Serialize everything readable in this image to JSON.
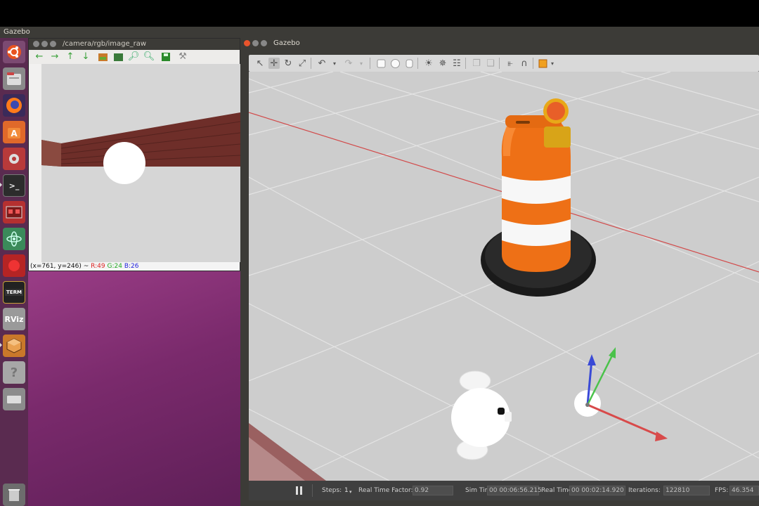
{
  "topbar": {
    "title": "Gazebo"
  },
  "image_window": {
    "title": "/camera/rgb/image_raw",
    "status": {
      "coords": "(x=761, y=246) ~",
      "r": "R:49",
      "g": "G:24",
      "b": "B:26"
    }
  },
  "gazebo_window": {
    "title": "Gazebo",
    "bottom": {
      "steps_label": "Steps:",
      "steps_value": "1",
      "rtf_label": "Real Time Factor:",
      "rtf_value": "0.92",
      "sim_time_label": "Sim Time:",
      "sim_time_value": "00 00:06:56.215",
      "real_time_label": "Real Time:",
      "real_time_value": "00 00:02:14.920",
      "iterations_label": "Iterations:",
      "iterations_value": "122810",
      "fps_label": "FPS:",
      "fps_value": "46.354"
    }
  },
  "launcher": {
    "items": [
      "ubuntu-dash",
      "files",
      "firefox",
      "software-center",
      "system-settings",
      "terminal",
      "remote-desktop",
      "atom",
      "recorder",
      "term",
      "rviz",
      "gazebo",
      "help",
      "usb-drive",
      "trash"
    ],
    "rviz_label": "RViz",
    "term_label": "TERM"
  }
}
